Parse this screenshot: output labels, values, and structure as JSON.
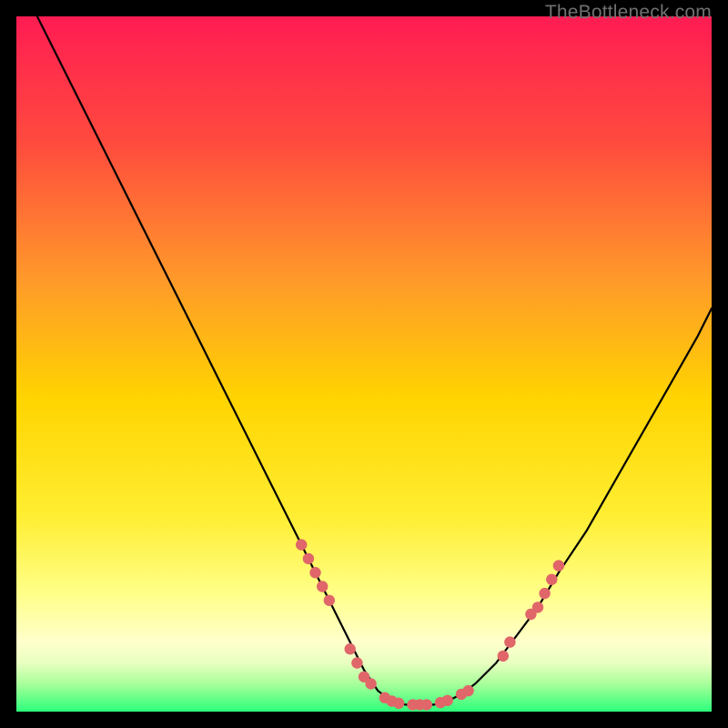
{
  "watermark": "TheBottleneck.com",
  "colors": {
    "bg": "#000000",
    "gradient_top": "#ff1c53",
    "gradient_mid_upper": "#ff7a2a",
    "gradient_mid": "#ffd400",
    "gradient_lower": "#ffff66",
    "gradient_pale": "#ffffcc",
    "gradient_bottom": "#2cff7a",
    "curve": "#000000",
    "dot_fill": "#e06669",
    "dot_stroke": "#e06669"
  },
  "chart_data": {
    "type": "line",
    "title": "",
    "xlabel": "",
    "ylabel": "",
    "xlim": [
      0,
      100
    ],
    "ylim": [
      0,
      100
    ],
    "series": [
      {
        "name": "bottleneck-curve",
        "x": [
          3,
          6,
          9,
          12,
          15,
          18,
          21,
          24,
          27,
          30,
          33,
          36,
          39,
          42,
          45,
          48,
          50,
          52,
          54,
          56,
          58,
          60,
          62,
          64,
          66,
          69,
          72,
          75,
          78,
          82,
          86,
          90,
          94,
          98,
          100
        ],
        "y": [
          100,
          94,
          88,
          82,
          76,
          70,
          64,
          58,
          52,
          46,
          40,
          34,
          28,
          22,
          16,
          10,
          6,
          3,
          1.5,
          1,
          1,
          1,
          1.5,
          2.5,
          4,
          7,
          11,
          15,
          20,
          26,
          33,
          40,
          47,
          54,
          58
        ]
      }
    ],
    "highlight_points": {
      "name": "curve-dots",
      "points": [
        {
          "x": 41,
          "y": 24
        },
        {
          "x": 42,
          "y": 22
        },
        {
          "x": 43,
          "y": 20
        },
        {
          "x": 44,
          "y": 18
        },
        {
          "x": 45,
          "y": 16
        },
        {
          "x": 48,
          "y": 9
        },
        {
          "x": 49,
          "y": 7
        },
        {
          "x": 50,
          "y": 5
        },
        {
          "x": 51,
          "y": 4
        },
        {
          "x": 53,
          "y": 2
        },
        {
          "x": 54,
          "y": 1.5
        },
        {
          "x": 55,
          "y": 1.2
        },
        {
          "x": 57,
          "y": 1
        },
        {
          "x": 58,
          "y": 1
        },
        {
          "x": 59,
          "y": 1
        },
        {
          "x": 61,
          "y": 1.3
        },
        {
          "x": 62,
          "y": 1.6
        },
        {
          "x": 64,
          "y": 2.5
        },
        {
          "x": 65,
          "y": 3
        },
        {
          "x": 70,
          "y": 8
        },
        {
          "x": 71,
          "y": 10
        },
        {
          "x": 74,
          "y": 14
        },
        {
          "x": 75,
          "y": 15
        },
        {
          "x": 76,
          "y": 17
        },
        {
          "x": 77,
          "y": 19
        },
        {
          "x": 78,
          "y": 21
        }
      ]
    }
  }
}
